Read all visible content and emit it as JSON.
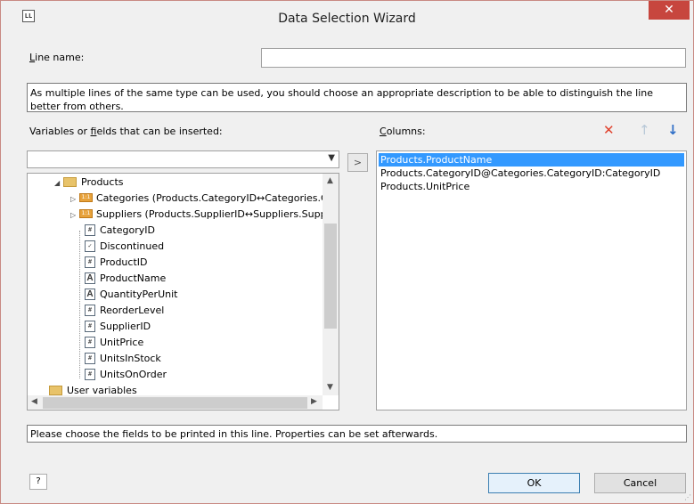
{
  "window": {
    "title": "Data Selection Wizard",
    "app_icon_text": "LL",
    "close_glyph": "✕"
  },
  "line_name": {
    "label_first": "L",
    "label_rest": "ine name:",
    "value": ""
  },
  "description_hint": "As multiple lines of the same type can be used, you should choose an appropriate description to be able to distinguish the line better from others.",
  "fields_panel": {
    "label_before": "Variables or ",
    "label_hotkey": "f",
    "label_after": "ields that can be inserted:",
    "combo_value": "",
    "tree": [
      {
        "label": "Products",
        "kind": "folder",
        "expanded": true
      },
      {
        "label": "Categories (Products.CategoryID↔Categories.C",
        "kind": "relation"
      },
      {
        "label": "Suppliers (Products.SupplierID↔Suppliers.Supp",
        "kind": "relation"
      },
      {
        "label": "CategoryID",
        "kind": "number"
      },
      {
        "label": "Discontinued",
        "kind": "bool"
      },
      {
        "label": "ProductID",
        "kind": "number"
      },
      {
        "label": "ProductName",
        "kind": "text"
      },
      {
        "label": "QuantityPerUnit",
        "kind": "text"
      },
      {
        "label": "ReorderLevel",
        "kind": "number"
      },
      {
        "label": "SupplierID",
        "kind": "number"
      },
      {
        "label": "UnitPrice",
        "kind": "number"
      },
      {
        "label": "UnitsInStock",
        "kind": "number"
      },
      {
        "label": "UnitsOnOrder",
        "kind": "number"
      },
      {
        "label": "User variables",
        "kind": "user-folder"
      }
    ]
  },
  "add_button_label": ">",
  "columns_panel": {
    "label_first": "C",
    "label_rest": "olumns:",
    "items": [
      "Products.ProductName",
      "Products.CategoryID@Categories.CategoryID:CategoryID",
      "Products.UnitPrice"
    ],
    "selected_index": 0,
    "delete_glyph": "✕",
    "up_glyph": "↑",
    "down_glyph": "↓"
  },
  "bottom_hint": "Please choose the fields to be printed in this line. Properties can be set afterwards.",
  "buttons": {
    "help": "?",
    "ok": "OK",
    "cancel": "Cancel"
  },
  "colors": {
    "accent_selection": "#3399ff",
    "close_button": "#c7463e",
    "delete_icon": "#e0412c",
    "down_arrow": "#2f6fc7"
  }
}
